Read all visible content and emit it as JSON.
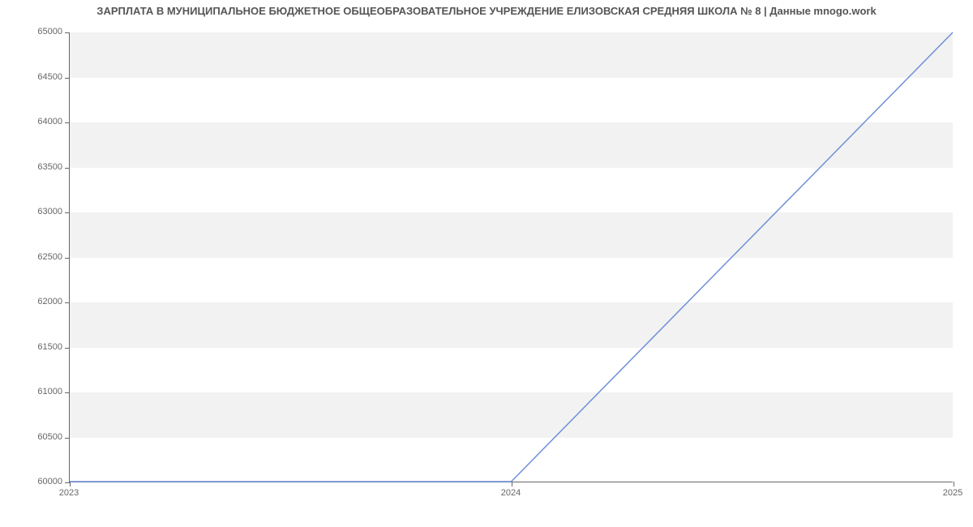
{
  "chart_data": {
    "type": "line",
    "title": "ЗАРПЛАТА В МУНИЦИПАЛЬНОЕ БЮДЖЕТНОЕ ОБЩЕОБРАЗОВАТЕЛЬНОЕ УЧРЕЖДЕНИЕ ЕЛИЗОВСКАЯ СРЕДНЯЯ ШКОЛА № 8 | Данные mnogo.work",
    "xlabel": "",
    "ylabel": "",
    "x_ticks": [
      "2023",
      "2024",
      "2025"
    ],
    "y_ticks": [
      60000,
      60500,
      61000,
      61500,
      62000,
      62500,
      63000,
      63500,
      64000,
      64500,
      65000
    ],
    "xlim": [
      "2023",
      "2025"
    ],
    "ylim": [
      60000,
      65000
    ],
    "grid": "horizontal-bands",
    "series": [
      {
        "name": "salary",
        "color": "#6f8fd8",
        "x": [
          "2023",
          "2024",
          "2025"
        ],
        "y": [
          60000,
          60000,
          65000
        ]
      }
    ]
  }
}
